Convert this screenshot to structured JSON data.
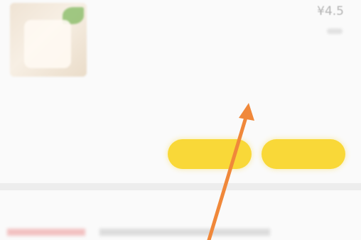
{
  "order": {
    "title": "",
    "price": "¥4.5",
    "summary": "",
    "buttons": {
      "plain": "",
      "primary": "",
      "secondary": ""
    }
  },
  "next_order": {
    "left_text": "",
    "right_text": ""
  },
  "colors": {
    "accent": "#f9d838",
    "arrow": "#f0883a"
  }
}
